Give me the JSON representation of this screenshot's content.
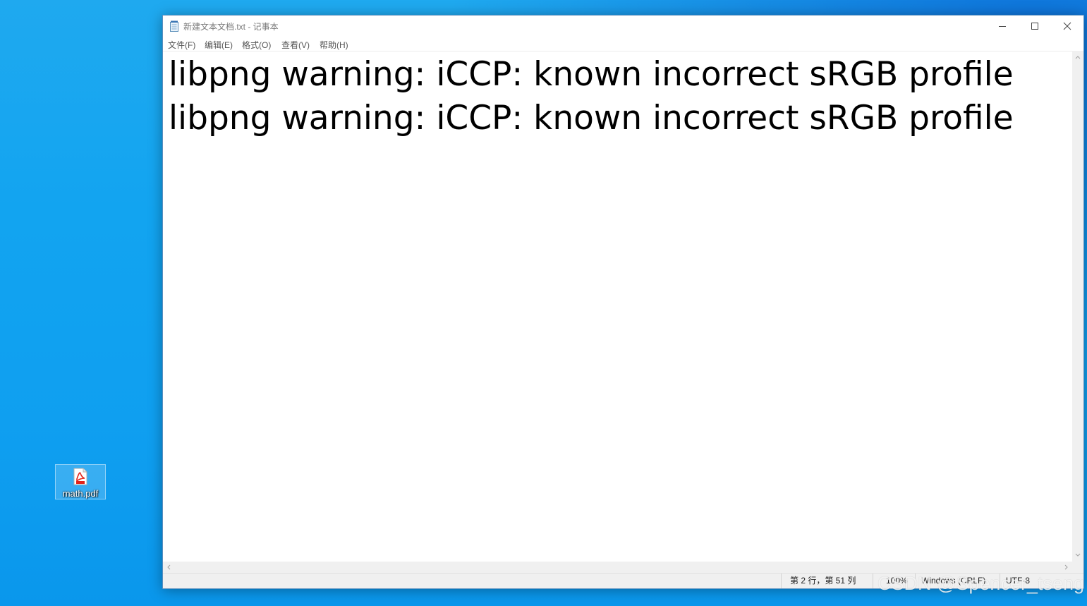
{
  "desktop": {
    "icons": [
      {
        "label": "math.pdf",
        "icon": "pdf-file-icon"
      }
    ]
  },
  "window": {
    "title": "新建文本文档.txt - 记事本",
    "app_icon": "notepad-icon",
    "controls": {
      "minimize": "minimize-icon",
      "maximize": "maximize-icon",
      "close": "close-icon"
    }
  },
  "menu": {
    "items": [
      {
        "label": "文件(F)"
      },
      {
        "label": "编辑(E)"
      },
      {
        "label": "格式(O)"
      },
      {
        "label": "查看(V)"
      },
      {
        "label": "帮助(H)"
      }
    ]
  },
  "editor": {
    "lines": [
      "libpng warning: iCCP: known incorrect sRGB profile",
      "libpng warning: iCCP: known incorrect sRGB profile"
    ]
  },
  "statusbar": {
    "position": "第 2 行，第 51 列",
    "zoom": "100%",
    "line_ending": "Windows (CRLF)",
    "encoding": "UTF-8"
  },
  "watermark": {
    "text": "CSDN @Spencer_tseng"
  },
  "colors": {
    "desktop": "#12a4f0",
    "pdf_red": "#e2231a"
  }
}
